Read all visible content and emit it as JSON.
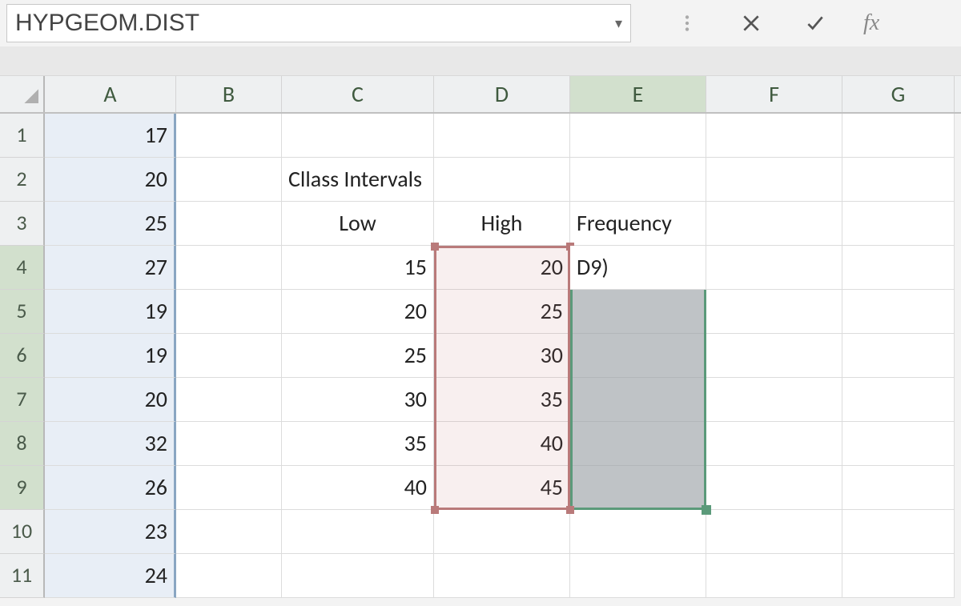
{
  "namebox": {
    "value": "HYPGEOM.DIST"
  },
  "formula_buttons": {
    "more": "⋮",
    "cancel": "×",
    "enter": "✓",
    "fx": "fx"
  },
  "columns": [
    "A",
    "B",
    "C",
    "D",
    "E",
    "F",
    "G"
  ],
  "rows": [
    "1",
    "2",
    "3",
    "4",
    "5",
    "6",
    "7",
    "8",
    "9",
    "10",
    "11"
  ],
  "colA": [
    "17",
    "20",
    "25",
    "27",
    "19",
    "19",
    "20",
    "32",
    "26",
    "23",
    "24"
  ],
  "labels": {
    "c2": "Cllass Intervals",
    "c3": "Low",
    "d3": "High",
    "e3": "Frequency",
    "e4": "D9)"
  },
  "low": [
    "15",
    "20",
    "25",
    "30",
    "35",
    "40"
  ],
  "high": [
    "20",
    "25",
    "30",
    "35",
    "40",
    "45"
  ],
  "selected_range_red": "D4:D9",
  "selected_range_green": "E4:E9",
  "colors": {
    "rowhdr_sel": "#d2e0cd",
    "range_red": "#b97a7a",
    "range_green": "#5b9a7a"
  }
}
